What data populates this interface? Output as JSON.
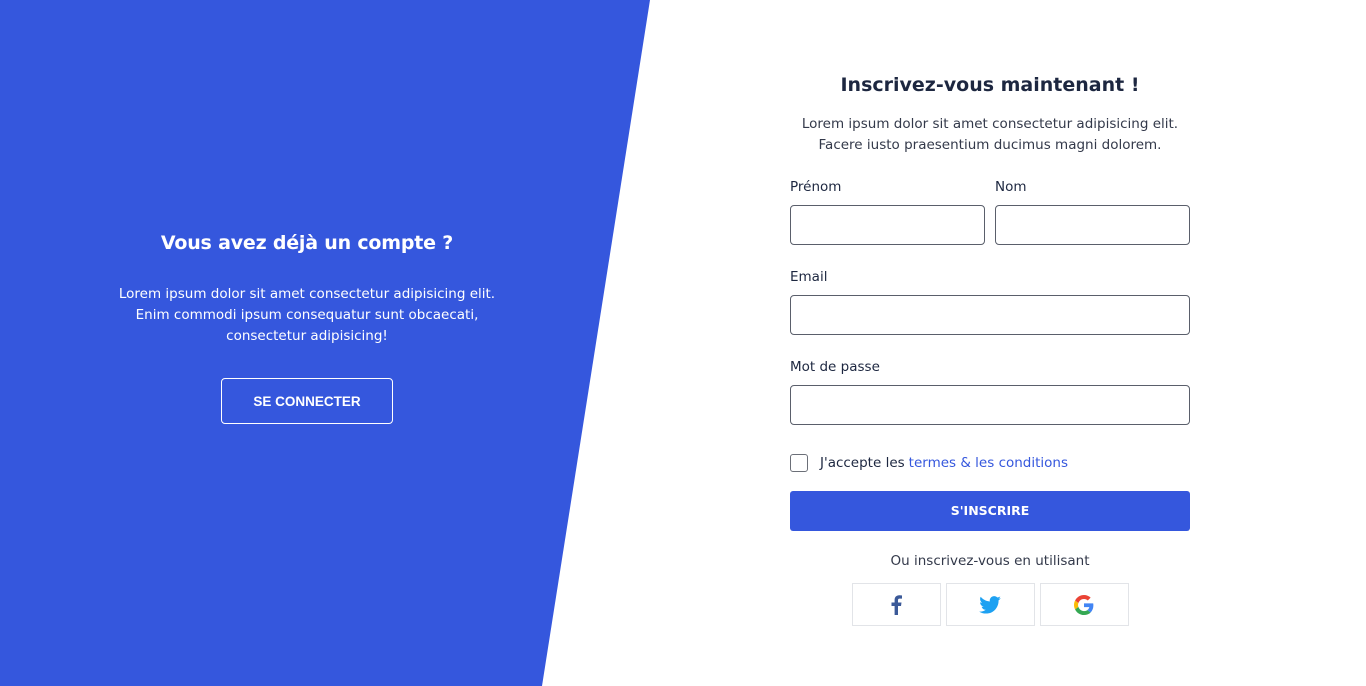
{
  "colors": {
    "brand": "#3557dd",
    "facebook": "#3b5998",
    "twitter": "#1da1f2"
  },
  "left": {
    "title": "Vous avez déjà un compte ?",
    "desc_line1": "Lorem ipsum dolor sit amet consectetur adipisicing elit.",
    "desc_line2": "Enim commodi ipsum consequatur sunt obcaecati,",
    "desc_line3": "consectetur adipisicing!",
    "login_button": "SE CONNECTER"
  },
  "form": {
    "title": "Inscrivez-vous maintenant !",
    "desc_line1": "Lorem ipsum dolor sit amet consectetur adipisicing elit.",
    "desc_line2": "Facere iusto praesentium ducimus magni dolorem.",
    "firstname_label": "Prénom",
    "firstname_value": "",
    "lastname_label": "Nom",
    "lastname_value": "",
    "email_label": "Email",
    "email_value": "",
    "password_label": "Mot de passe",
    "password_value": "",
    "terms_prefix": "J'accepte les",
    "terms_link": "termes & les conditions",
    "terms_checked": false,
    "signup_button": "S'INSCRIRE",
    "or_text": "Ou inscrivez-vous en utilisant"
  },
  "social": [
    {
      "name": "facebook-icon"
    },
    {
      "name": "twitter-icon"
    },
    {
      "name": "google-icon"
    }
  ]
}
